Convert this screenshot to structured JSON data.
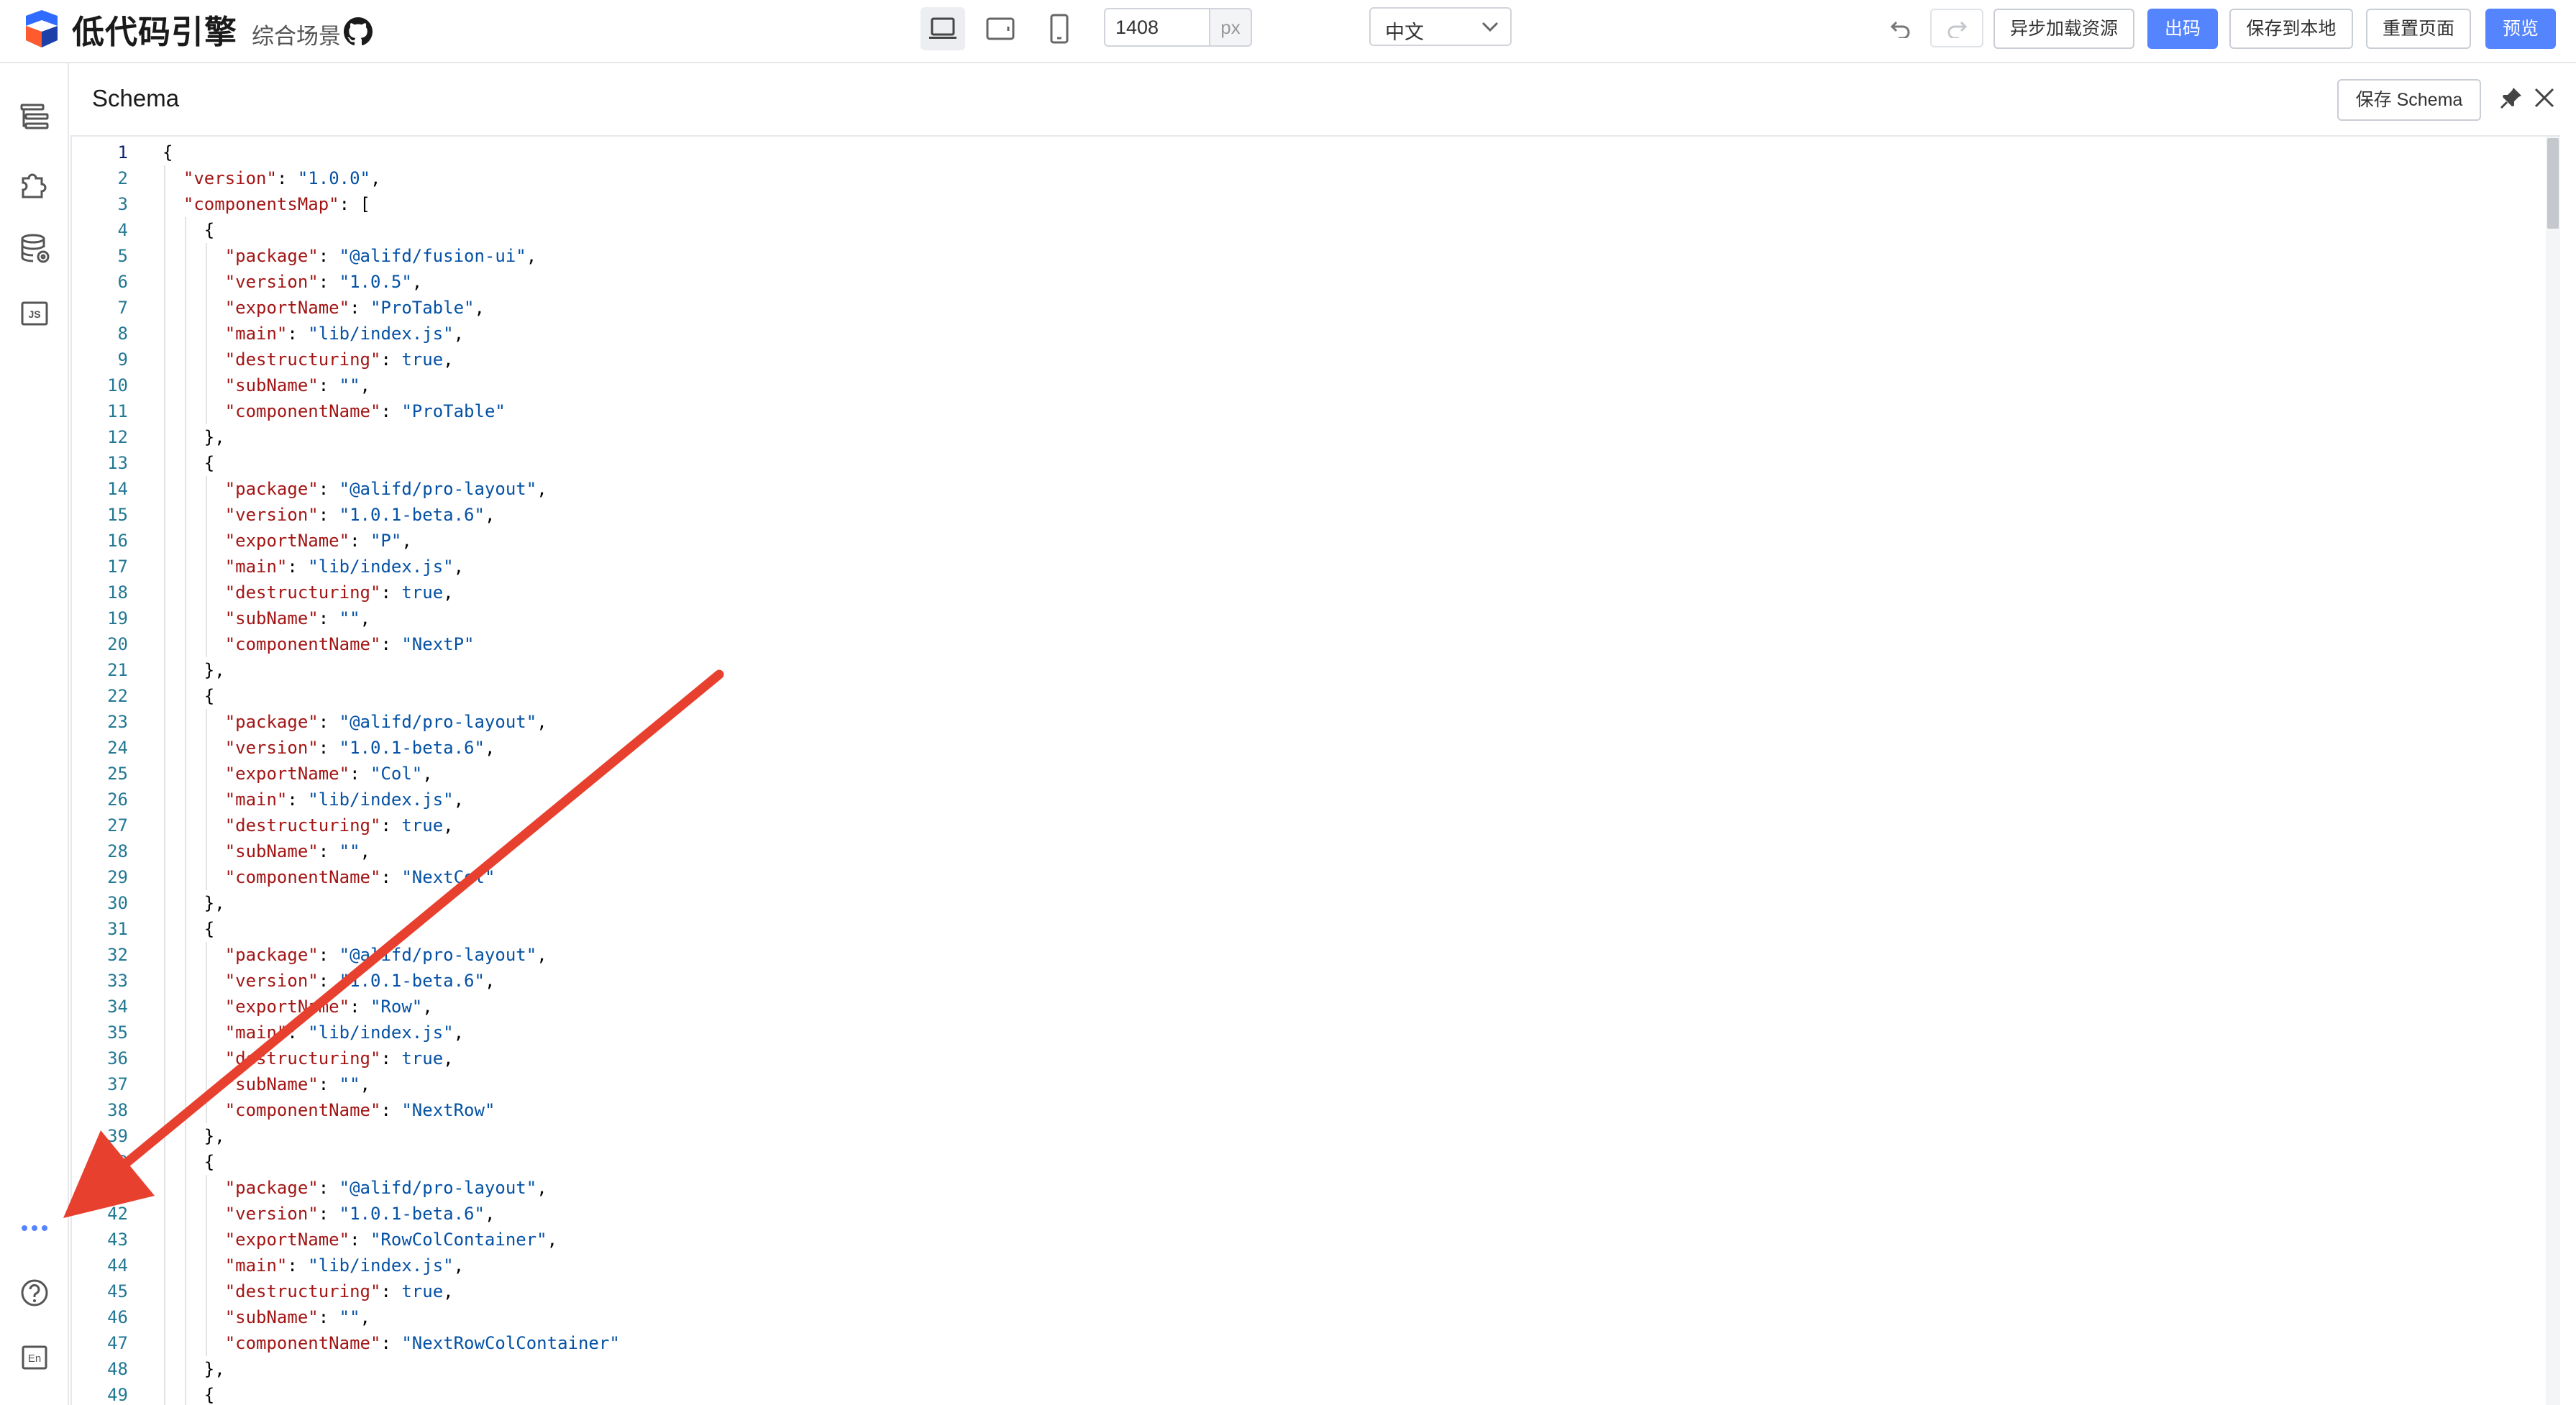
{
  "header": {
    "logo_text": "低代码引擎",
    "scene_label": "综合场景",
    "width_value": "1408",
    "width_unit": "px",
    "language": "中文",
    "buttons": {
      "async_load": "异步加载资源",
      "export_code": "出码",
      "save_local": "保存到本地",
      "reset_page": "重置页面",
      "preview": "预览"
    }
  },
  "sidebar": {
    "items": [
      "outline-tree-icon",
      "component-library-icon",
      "datasource-icon",
      "js-code-icon"
    ],
    "bottom": [
      "more-icon",
      "help-icon",
      "language-switch-icon"
    ],
    "lang_badge": "En"
  },
  "panel": {
    "title": "Schema",
    "save_button": "保存 Schema"
  },
  "editor": {
    "lines": [
      [
        0,
        "{"
      ],
      [
        1,
        "\"version\": \"1.0.0\","
      ],
      [
        1,
        "\"componentsMap\": ["
      ],
      [
        2,
        "{"
      ],
      [
        3,
        "\"package\": \"@alifd/fusion-ui\","
      ],
      [
        3,
        "\"version\": \"1.0.5\","
      ],
      [
        3,
        "\"exportName\": \"ProTable\","
      ],
      [
        3,
        "\"main\": \"lib/index.js\","
      ],
      [
        3,
        "\"destructuring\": true,"
      ],
      [
        3,
        "\"subName\": \"\","
      ],
      [
        3,
        "\"componentName\": \"ProTable\""
      ],
      [
        2,
        "},"
      ],
      [
        2,
        "{"
      ],
      [
        3,
        "\"package\": \"@alifd/pro-layout\","
      ],
      [
        3,
        "\"version\": \"1.0.1-beta.6\","
      ],
      [
        3,
        "\"exportName\": \"P\","
      ],
      [
        3,
        "\"main\": \"lib/index.js\","
      ],
      [
        3,
        "\"destructuring\": true,"
      ],
      [
        3,
        "\"subName\": \"\","
      ],
      [
        3,
        "\"componentName\": \"NextP\""
      ],
      [
        2,
        "},"
      ],
      [
        2,
        "{"
      ],
      [
        3,
        "\"package\": \"@alifd/pro-layout\","
      ],
      [
        3,
        "\"version\": \"1.0.1-beta.6\","
      ],
      [
        3,
        "\"exportName\": \"Col\","
      ],
      [
        3,
        "\"main\": \"lib/index.js\","
      ],
      [
        3,
        "\"destructuring\": true,"
      ],
      [
        3,
        "\"subName\": \"\","
      ],
      [
        3,
        "\"componentName\": \"NextCol\""
      ],
      [
        2,
        "},"
      ],
      [
        2,
        "{"
      ],
      [
        3,
        "\"package\": \"@alifd/pro-layout\","
      ],
      [
        3,
        "\"version\": \"1.0.1-beta.6\","
      ],
      [
        3,
        "\"exportName\": \"Row\","
      ],
      [
        3,
        "\"main\": \"lib/index.js\","
      ],
      [
        3,
        "\"destructuring\": true,"
      ],
      [
        3,
        "\"subName\": \"\","
      ],
      [
        3,
        "\"componentName\": \"NextRow\""
      ],
      [
        2,
        "},"
      ],
      [
        2,
        "{"
      ],
      [
        3,
        "\"package\": \"@alifd/pro-layout\","
      ],
      [
        3,
        "\"version\": \"1.0.1-beta.6\","
      ],
      [
        3,
        "\"exportName\": \"RowColContainer\","
      ],
      [
        3,
        "\"main\": \"lib/index.js\","
      ],
      [
        3,
        "\"destructuring\": true,"
      ],
      [
        3,
        "\"subName\": \"\","
      ],
      [
        3,
        "\"componentName\": \"NextRowColContainer\""
      ],
      [
        2,
        "},"
      ],
      [
        2,
        "{"
      ]
    ]
  },
  "colors": {
    "primary": "#5584ff",
    "annotation_arrow": "#e8402f",
    "json_key": "#a31515",
    "json_string": "#0451a5",
    "line_number": "#237893"
  }
}
